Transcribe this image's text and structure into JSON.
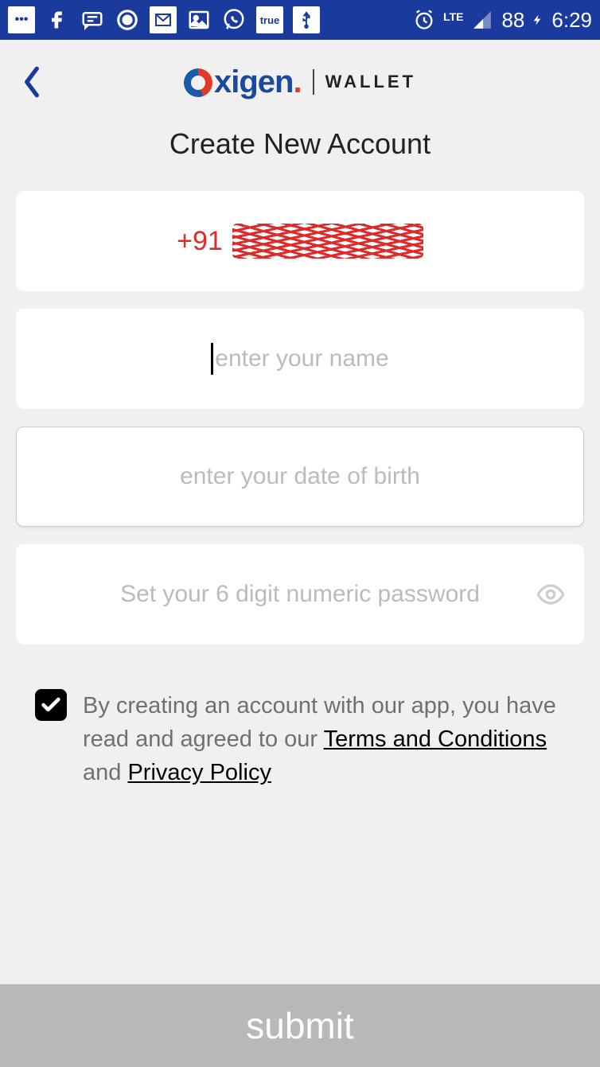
{
  "status_bar": {
    "battery": "88",
    "time": "6:29",
    "network_label": "LTE",
    "icons": {
      "more": "more-icon",
      "facebook": "facebook-icon",
      "messages": "messages-icon",
      "circle_app": "circle-app-icon",
      "gmail": "gmail-icon",
      "gallery": "gallery-icon",
      "whatsapp": "whatsapp-icon",
      "true_app": "true",
      "usb": "usb-icon",
      "alarm": "alarm-icon",
      "signal": "signal-icon",
      "charging": "charging-icon"
    }
  },
  "header": {
    "back": "back",
    "brand_primary": "xigen",
    "brand_dot": ".",
    "brand_secondary": "WALLET"
  },
  "page": {
    "title": "Create New Account"
  },
  "form": {
    "phone_prefix": "+91",
    "phone_value_redacted": true,
    "name_value": "",
    "name_placeholder": "enter your name",
    "dob_value": "",
    "dob_placeholder": "enter your date of birth",
    "password_value": "",
    "password_placeholder": "Set your 6 digit numeric password"
  },
  "consent": {
    "checked": true,
    "text_1": "By creating an account with our app, you have read and agreed to our ",
    "terms_link": "Terms and Conditions",
    "text_2": " and ",
    "privacy_link": "Privacy Policy"
  },
  "actions": {
    "submit": "submit"
  },
  "colors": {
    "status_bar_bg": "#1a3a9e",
    "accent_red": "#e02a2a",
    "brand_blue": "#1a4aa0",
    "submit_bg": "#b8b8b8"
  }
}
